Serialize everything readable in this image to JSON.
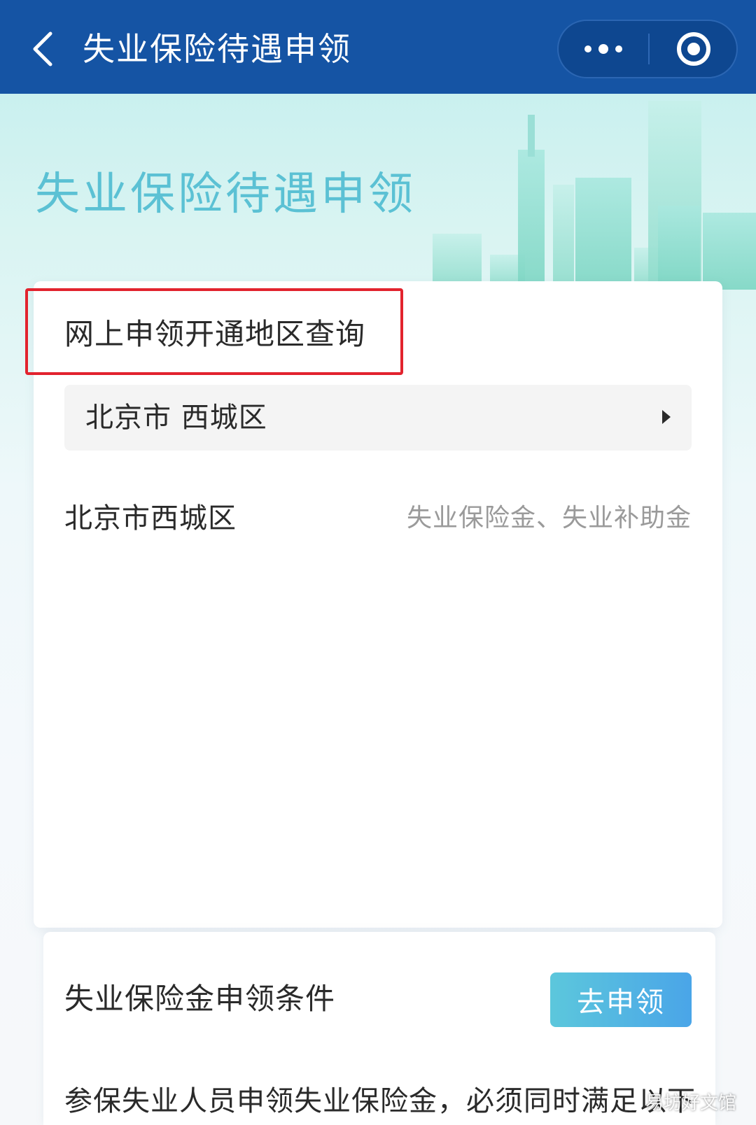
{
  "navbar": {
    "title": "失业保险待遇申领",
    "back_icon": "chevron-left-icon",
    "more_icon": "more-dots-icon",
    "close_icon": "target-circle-icon"
  },
  "banner": {
    "title": "失业保险待遇申领"
  },
  "region_query": {
    "title": "网上申领开通地区查询",
    "selected_region": "北京市 西城区",
    "results": [
      {
        "region": "北京市西城区",
        "benefits": "失业保险金、失业补助金"
      }
    ]
  },
  "conditions": {
    "title": "失业保险金申领条件",
    "apply_label": "去申领",
    "description": "参保失业人员申领失业保险金，必须同时满足以下"
  },
  "watermark": "易坊好文馆",
  "colors": {
    "navbar_bg": "#1554a4",
    "banner_title": "#5bc1d4",
    "highlight_border": "#e2232e",
    "button_gradient_start": "#5cc7dc",
    "button_gradient_end": "#4aa5e8"
  }
}
